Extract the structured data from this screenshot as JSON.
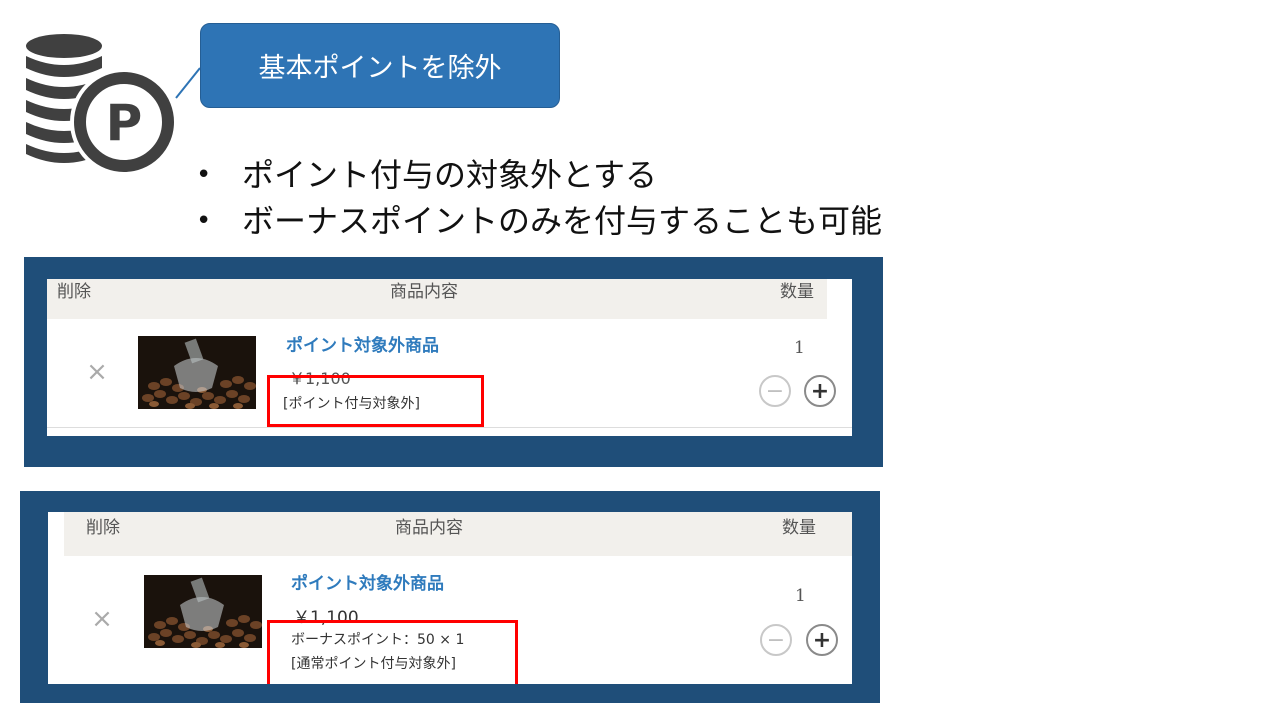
{
  "callout": {
    "title": "基本ポイントを除外"
  },
  "bullets": [
    "ポイント付与の対象外とする",
    "ボーナスポイントのみを付与することも可能"
  ],
  "icon": {
    "name": "coin-stack-points-icon",
    "letter": "P",
    "color": "#404040"
  },
  "colors": {
    "panel": "#1f4e79",
    "callout": "#2e74b5",
    "highlight": "#ff0000",
    "link": "#2f7bbd"
  },
  "cart1": {
    "headers": {
      "delete": "削除",
      "item": "商品内容",
      "qty": "数量"
    },
    "remove": "×",
    "product_name": "ポイント対象外商品",
    "price": "￥1,100",
    "notes": [
      "[ポイント付与対象外]"
    ],
    "quantity": "1",
    "minus": "−",
    "plus": "+"
  },
  "cart2": {
    "headers": {
      "delete": "削除",
      "item": "商品内容",
      "qty": "数量"
    },
    "remove": "×",
    "product_name": "ポイント対象外商品",
    "price": "￥1,100",
    "notes": [
      "ボーナスポイント：50 × 1",
      "[通常ポイント付与対象外]"
    ],
    "quantity": "1",
    "minus": "−",
    "plus": "+"
  }
}
